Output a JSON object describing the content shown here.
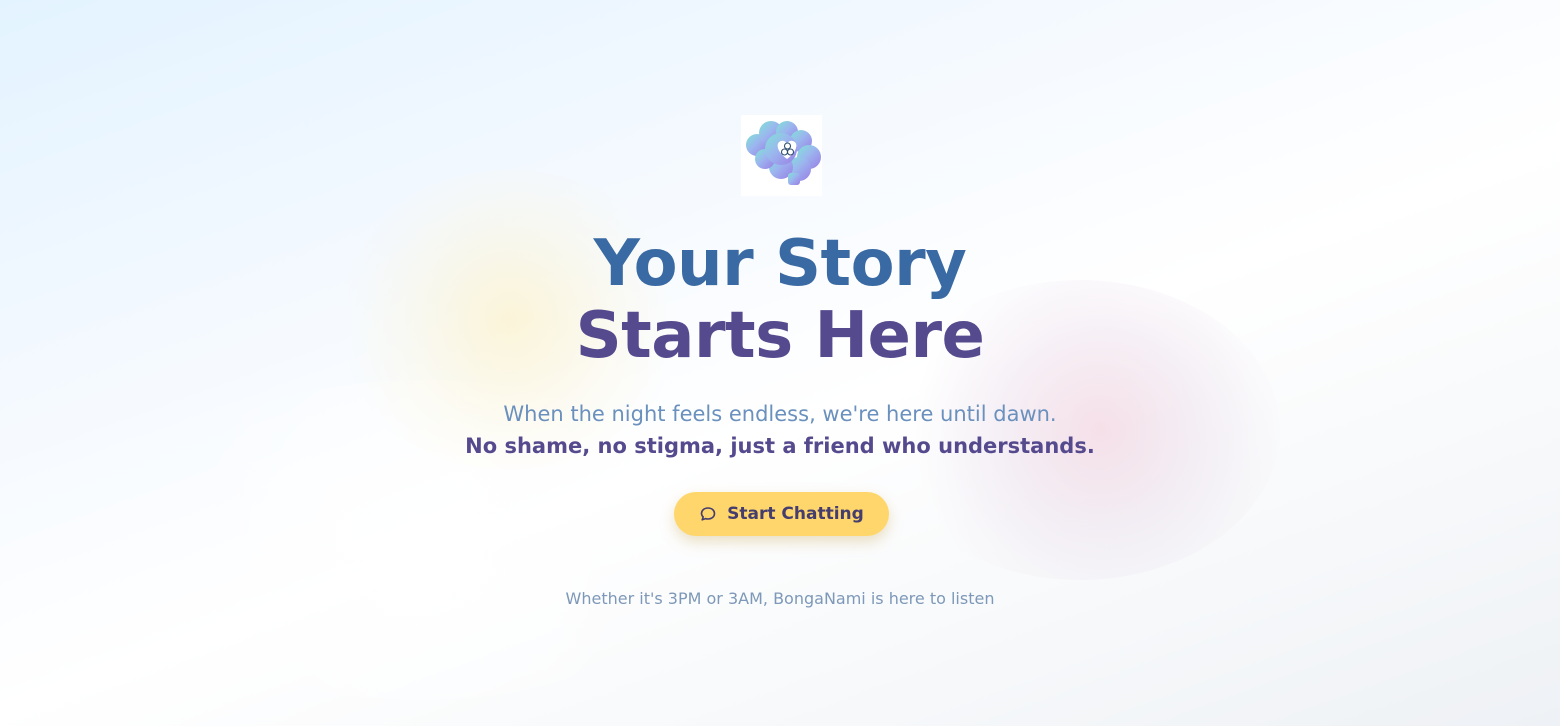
{
  "brand": {
    "logo_icon": "brain-heart-logo-icon"
  },
  "hero": {
    "title_line1": "Your Story",
    "title_line2": "Starts Here",
    "subtitle_line1": "When the night feels endless, we're here until dawn.",
    "subtitle_line2": "No shame, no stigma, just a friend who understands."
  },
  "cta": {
    "label": "Start Chatting",
    "icon": "chat-bubble-icon"
  },
  "footer": {
    "note": "Whether it's 3PM or 3AM, BongaNami is here to listen"
  },
  "colors": {
    "title_primary": "#3a6aa3",
    "title_secondary": "#564a8e",
    "subtitle": "#6a90bd",
    "button": "#ffd66b",
    "button_text": "#453d6e",
    "footer_text": "#7d98b8"
  }
}
